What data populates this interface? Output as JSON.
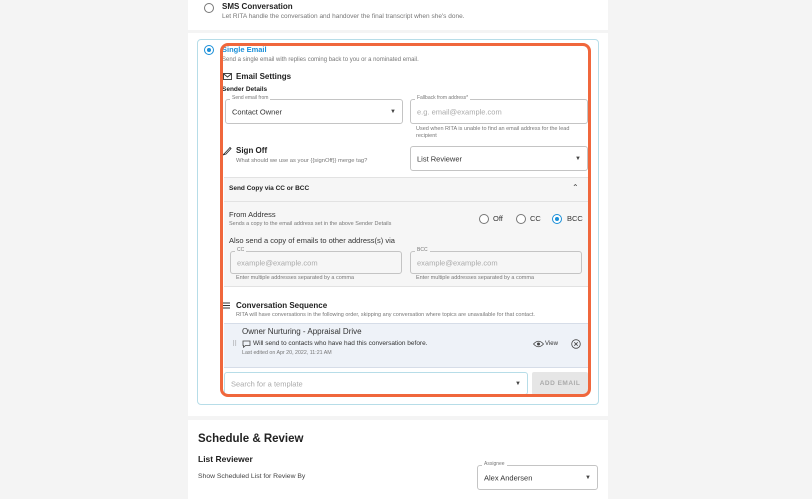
{
  "sms_option": {
    "title": "SMS Conversation",
    "desc": "Let RITA handle the conversation and handover the final transcript when she's done."
  },
  "email_option": {
    "title": "Single Email",
    "desc": "Send a single email with replies coming back to you or a nominated email."
  },
  "email_settings": {
    "title": "Email Settings",
    "sender_details": "Sender Details",
    "send_from": {
      "label": "Send email from",
      "value": "Contact Owner"
    },
    "fallback": {
      "label": "Fallback from address*",
      "placeholder": "e.g. email@example.com",
      "help": "Used when RITA is unable to find an email address for the lead recipient"
    }
  },
  "sign_off": {
    "title": "Sign Off",
    "desc": "What should we use as your {{signOff}} merge tag?",
    "value": "List Reviewer"
  },
  "copy_section": {
    "title": "Send Copy via CC or BCC",
    "from_address": "From Address",
    "from_desc": "Sends a copy to the email address set in the above Sender Details",
    "options": [
      "Off",
      "CC",
      "BCC"
    ],
    "selected": "BCC",
    "also_send": "Also send a copy of emails to other address(s) via",
    "cc": {
      "label": "CC",
      "placeholder": "example@example.com",
      "help": "Enter multiple addresses separated by a comma"
    },
    "bcc": {
      "label": "BCC",
      "placeholder": "example@example.com",
      "help": "Enter multiple addresses separated by a comma"
    }
  },
  "sequence": {
    "title": "Conversation Sequence",
    "desc": "RITA will have conversations in the following order, skipping any conversation where topics are unavailable for that contact.",
    "item": {
      "title": "Owner Nurturing - Appraisal Drive",
      "note": "Will send to contacts who have had this conversation before.",
      "edited": "Last edited on Apr 20, 2022, 11:21 AM",
      "view_label": "View"
    },
    "search_placeholder": "Search for a template",
    "add_label": "ADD EMAIL"
  },
  "schedule": {
    "title": "Schedule & Review",
    "list_reviewer": "List Reviewer",
    "show_list": "Show Scheduled List for Review By",
    "assignee_label": "Assignee",
    "assignee_value": "Alex Andersen"
  }
}
